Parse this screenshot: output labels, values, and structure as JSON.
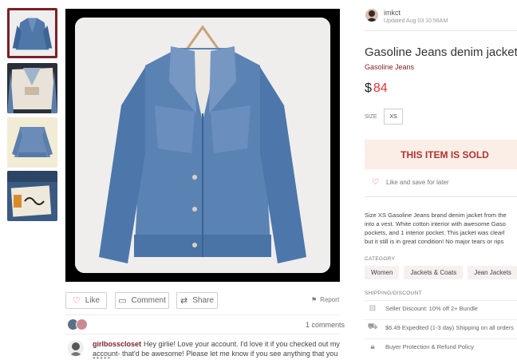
{
  "seller": {
    "username": "imkct",
    "updated": "Updated Aug 03 10:56AM"
  },
  "listing": {
    "title": "Gasoline Jeans denim jacket",
    "brand": "Gasoline Jeans",
    "currency": "$",
    "price": "84",
    "size_label": "SIZE",
    "size_value": "XS",
    "sold_text": "THIS ITEM IS SOLD",
    "like_save": "Like and save for later",
    "description": [
      "Size XS Gasoline Jeans brand denim jacket from the",
      "into a vest. White cotton interior with awesome Gaso",
      "pockets, and 1 interior pocket. This jacket was clearl",
      "but it still is in great condition! No major tears or rips"
    ]
  },
  "category": {
    "label": "CATEGORY",
    "chips": [
      "Women",
      "Jackets & Coats",
      "Jean Jackets"
    ]
  },
  "shipping": {
    "label": "SHIPPING/DISCOUNT",
    "rows": [
      {
        "icon": "discount-icon",
        "text": "Seller Discount: 10% off 2+ Bundle"
      },
      {
        "icon": "truck-icon",
        "text": "$6.49 Expedited (1-3 day) Shipping on all orders"
      },
      {
        "icon": "lock-icon",
        "text": "Buyer Protection & Refund Policy"
      }
    ]
  },
  "actions": {
    "like": "Like",
    "comment": "Comment",
    "share": "Share",
    "report": "Report"
  },
  "comments": {
    "count_text": "1 comments",
    "items": [
      {
        "user": "girlbosscloset",
        "text": "Hey girlie! Love your account. I'd love it if you checked out my account- that'd be awesome! Please let me know if you see anything that you like."
      }
    ]
  },
  "colors": {
    "accent": "#7d1f27",
    "price": "#e03434",
    "sold_bg": "#fbeee6",
    "sold_text": "#b23232"
  }
}
